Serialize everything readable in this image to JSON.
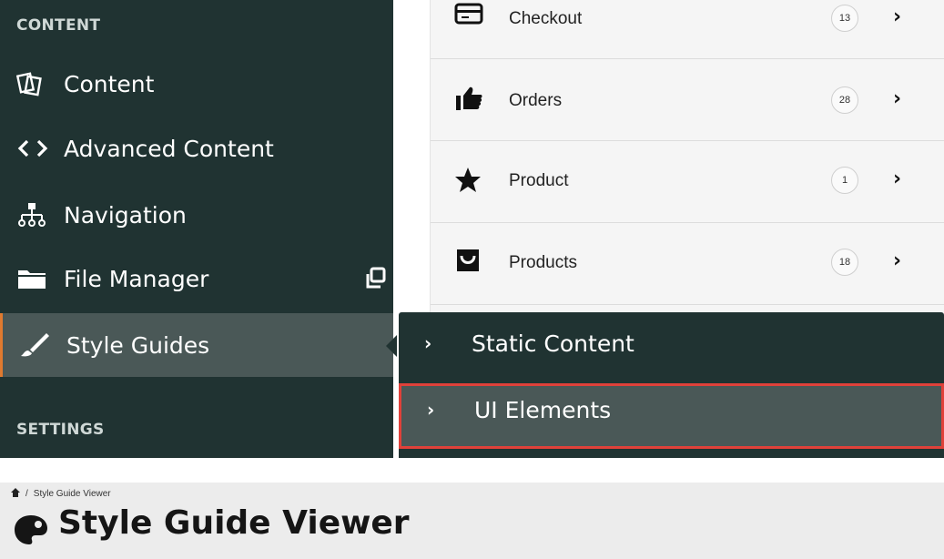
{
  "sidebar": {
    "section_content": "CONTENT",
    "section_settings": "SETTINGS",
    "items": [
      {
        "label": "Content",
        "icon": "documents-icon"
      },
      {
        "label": "Advanced Content",
        "icon": "code-brackets-icon"
      },
      {
        "label": "Navigation",
        "icon": "sitemap-icon"
      },
      {
        "label": "File Manager",
        "icon": "folder-icon",
        "action_icon": "external-window-icon"
      },
      {
        "label": "Style Guides",
        "icon": "paintbrush-icon",
        "active": true
      }
    ]
  },
  "list": {
    "rows": [
      {
        "label": "Checkout",
        "count": "13",
        "icon": "credit-card-icon"
      },
      {
        "label": "Orders",
        "count": "28",
        "icon": "thumbs-up-icon"
      },
      {
        "label": "Product",
        "count": "1",
        "icon": "star-icon"
      },
      {
        "label": "Products",
        "count": "18",
        "icon": "shopping-bag-icon"
      }
    ]
  },
  "flyout": {
    "items": [
      {
        "label": "Static Content"
      },
      {
        "label": "UI Elements",
        "highlighted": true
      }
    ]
  },
  "header": {
    "breadcrumb_separator": "/",
    "breadcrumb_current": "Style Guide Viewer",
    "title": "Style Guide Viewer"
  },
  "colors": {
    "sidebar_bg": "#203332",
    "active_bg": "#4a5857",
    "highlight_border": "#e0413a",
    "active_accent": "#e07a2f"
  }
}
